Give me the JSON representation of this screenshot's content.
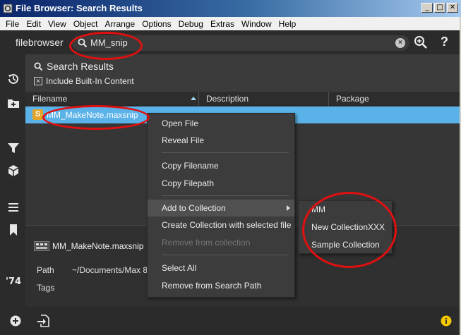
{
  "window": {
    "title": "File Browser: Search Results"
  },
  "menubar": [
    "File",
    "Edit",
    "View",
    "Object",
    "Arrange",
    "Options",
    "Debug",
    "Extras",
    "Window",
    "Help"
  ],
  "header": {
    "brand": "filebrowser",
    "search_value": "MM_snip",
    "help_label": "?"
  },
  "results": {
    "title": "Search Results",
    "include_builtin_label": "Include Built-In Content",
    "include_builtin_checked": true
  },
  "columns": [
    "Filename",
    "Description",
    "Package"
  ],
  "rows": [
    {
      "badge": "S",
      "filename": "MM_MakeNote.maxsnip"
    }
  ],
  "detail": {
    "filename": "MM_MakeNote.maxsnip",
    "path_label": "Path",
    "path_value": "~/Documents/Max 8",
    "tags_label": "Tags"
  },
  "context_menu": {
    "items": [
      {
        "label": "Open File",
        "enabled": true
      },
      {
        "label": "Reveal File",
        "enabled": true
      },
      {
        "label": "Copy Filename",
        "enabled": true
      },
      {
        "label": "Copy Filepath",
        "enabled": true
      },
      {
        "label": "Add to Collection",
        "enabled": true,
        "submenu": true
      },
      {
        "label": "Create Collection with selected file",
        "enabled": true
      },
      {
        "label": "Remove from collection",
        "enabled": false
      },
      {
        "label": "Select All",
        "enabled": true
      },
      {
        "label": "Remove from Search Path",
        "enabled": true
      }
    ]
  },
  "submenu": {
    "items": [
      "MM",
      "New CollectionXXX",
      "Sample Collection"
    ]
  },
  "colors": {
    "selection": "#5ab2e8",
    "annotation": "#e01010",
    "dark_bg": "#333333",
    "info": "#f5c800"
  },
  "icons": [
    "app-icon",
    "search-icon",
    "clear-icon",
    "zoom-in-icon",
    "help-icon",
    "history-icon",
    "add-folder-icon",
    "filter-icon",
    "package-icon",
    "list-icon",
    "bookmark-icon",
    "max-logo-icon",
    "add-icon",
    "import-icon",
    "info-icon"
  ]
}
